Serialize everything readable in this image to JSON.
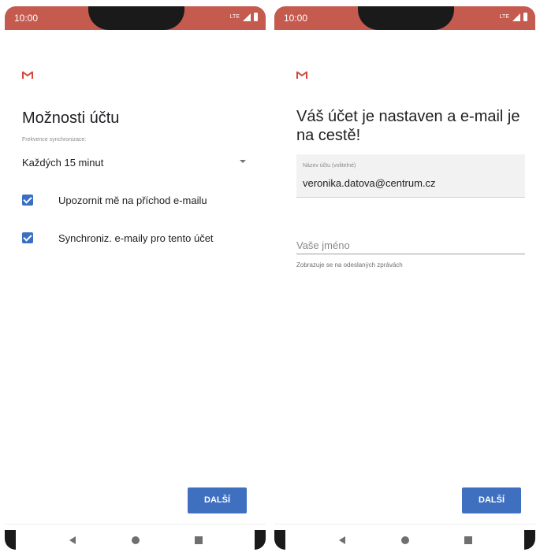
{
  "status_bar": {
    "time": "10:00",
    "network": "LTE"
  },
  "left_screen": {
    "title": "Možnosti účtu",
    "sync_label": "Frekvence synchronizace:",
    "sync_value": "Každých 15 minut",
    "checkboxes": [
      {
        "label": "Upozornit mě na příchod e-mailu",
        "checked": true
      },
      {
        "label": "Synchroniz. e-maily pro tento účet",
        "checked": true
      }
    ],
    "next_button": "DALŠÍ"
  },
  "right_screen": {
    "title": "Váš účet je nastaven a e-mail je na cestě!",
    "account_name_label": "Název účtu (volitelné)",
    "account_name_value": "veronika.datova@centrum.cz",
    "your_name_placeholder": "Vaše jméno",
    "your_name_helper": "Zobrazuje se na odeslaných zprávách",
    "next_button": "DALŠÍ"
  },
  "colors": {
    "status_bar": "#c55a4f",
    "accent": "#3f6fbf",
    "gmail_red": "#d44638"
  }
}
